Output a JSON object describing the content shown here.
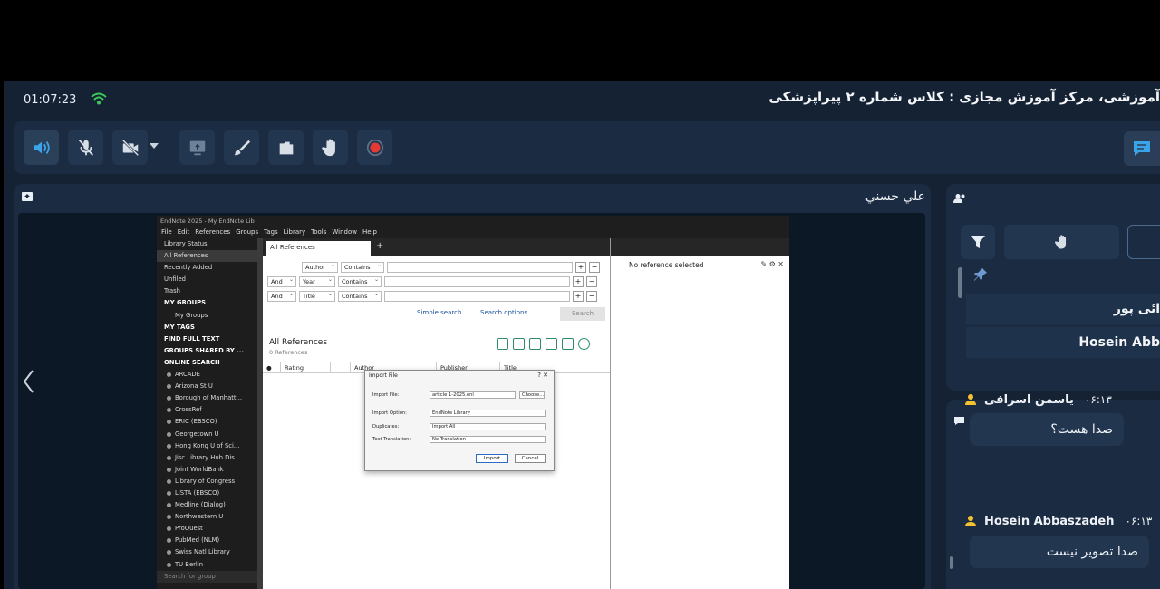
{
  "session": {
    "timer": "01:07:23",
    "title": "آموزشی، مرکز آموزش مجازی : کلاس شماره ۲ پیراپزشکی"
  },
  "presenter": {
    "name": "علي حسني"
  },
  "endnote": {
    "window_title": "EndNote 2025 - My EndNote Lib",
    "menu": [
      "File",
      "Edit",
      "References",
      "Groups",
      "Tags",
      "Library",
      "Tools",
      "Window",
      "Help"
    ],
    "sidebar": {
      "library_status": "Library Status",
      "all_references": "All References",
      "recently_added": "Recently Added",
      "unfiled": "Unfiled",
      "trash": "Trash",
      "my_groups_header": "MY GROUPS",
      "my_groups_item": "My Groups",
      "my_tags": "MY TAGS",
      "find_full_text": "FIND FULL TEXT",
      "groups_shared": "GROUPS SHARED BY ...",
      "online_search": "ONLINE SEARCH",
      "online_items": [
        "ARCADE",
        "Arizona St U",
        "Borough of Manhatt...",
        "CrossRef",
        "ERIC (EBSCO)",
        "Georgetown U",
        "Hong Kong U of Sci...",
        "Jisc Library Hub Dis...",
        "Joint WorldBank",
        "Library of Congress",
        "LISTA (EBSCO)",
        "Medline (Dialog)",
        "Northwestern U",
        "ProQuest",
        "PubMed (NLM)",
        "Swiss Natl Library",
        "TU Berlin"
      ],
      "search_placeholder": "Search for group"
    },
    "tab": "All References",
    "search_rows": [
      {
        "conj": "",
        "field": "Author",
        "op": "Contains"
      },
      {
        "conj": "And",
        "field": "Year",
        "op": "Contains"
      },
      {
        "conj": "And",
        "field": "Title",
        "op": "Contains"
      }
    ],
    "simple_search": "Simple search",
    "search_options": "Search options",
    "search_button": "Search",
    "ref_title": "All References",
    "ref_count": "0 References",
    "columns": [
      "Rating",
      "Author",
      "Publisher",
      "Title"
    ],
    "no_reference": "No reference selected",
    "dialog": {
      "title": "Import File",
      "help": "?",
      "import_file_label": "Import File:",
      "import_file_value": "article 1-2025.enl",
      "choose": "Choose...",
      "import_option_label": "Import Option:",
      "import_option_value": "EndNote Library",
      "duplicates_label": "Duplicates:",
      "duplicates_value": "Import All",
      "translation_label": "Text Translation:",
      "translation_value": "No Translation",
      "import_btn": "Import",
      "cancel_btn": "Cancel"
    }
  },
  "users": [
    {
      "name": "ائی پور"
    },
    {
      "name": "Hosein Abb"
    }
  ],
  "chat": [
    {
      "author": "یاسمن اسرافی",
      "time": "۰۶:۱۳",
      "text": "صدا هست؟"
    },
    {
      "author": "Hosein Abbaszadeh",
      "time": "۰۶:۱۳",
      "text": "صدا تصویر نیست"
    }
  ],
  "colors": {
    "accent": "#3ba3e8",
    "wifi": "#3cc85a",
    "record": "#e53935",
    "panel": "#1b2c42"
  }
}
